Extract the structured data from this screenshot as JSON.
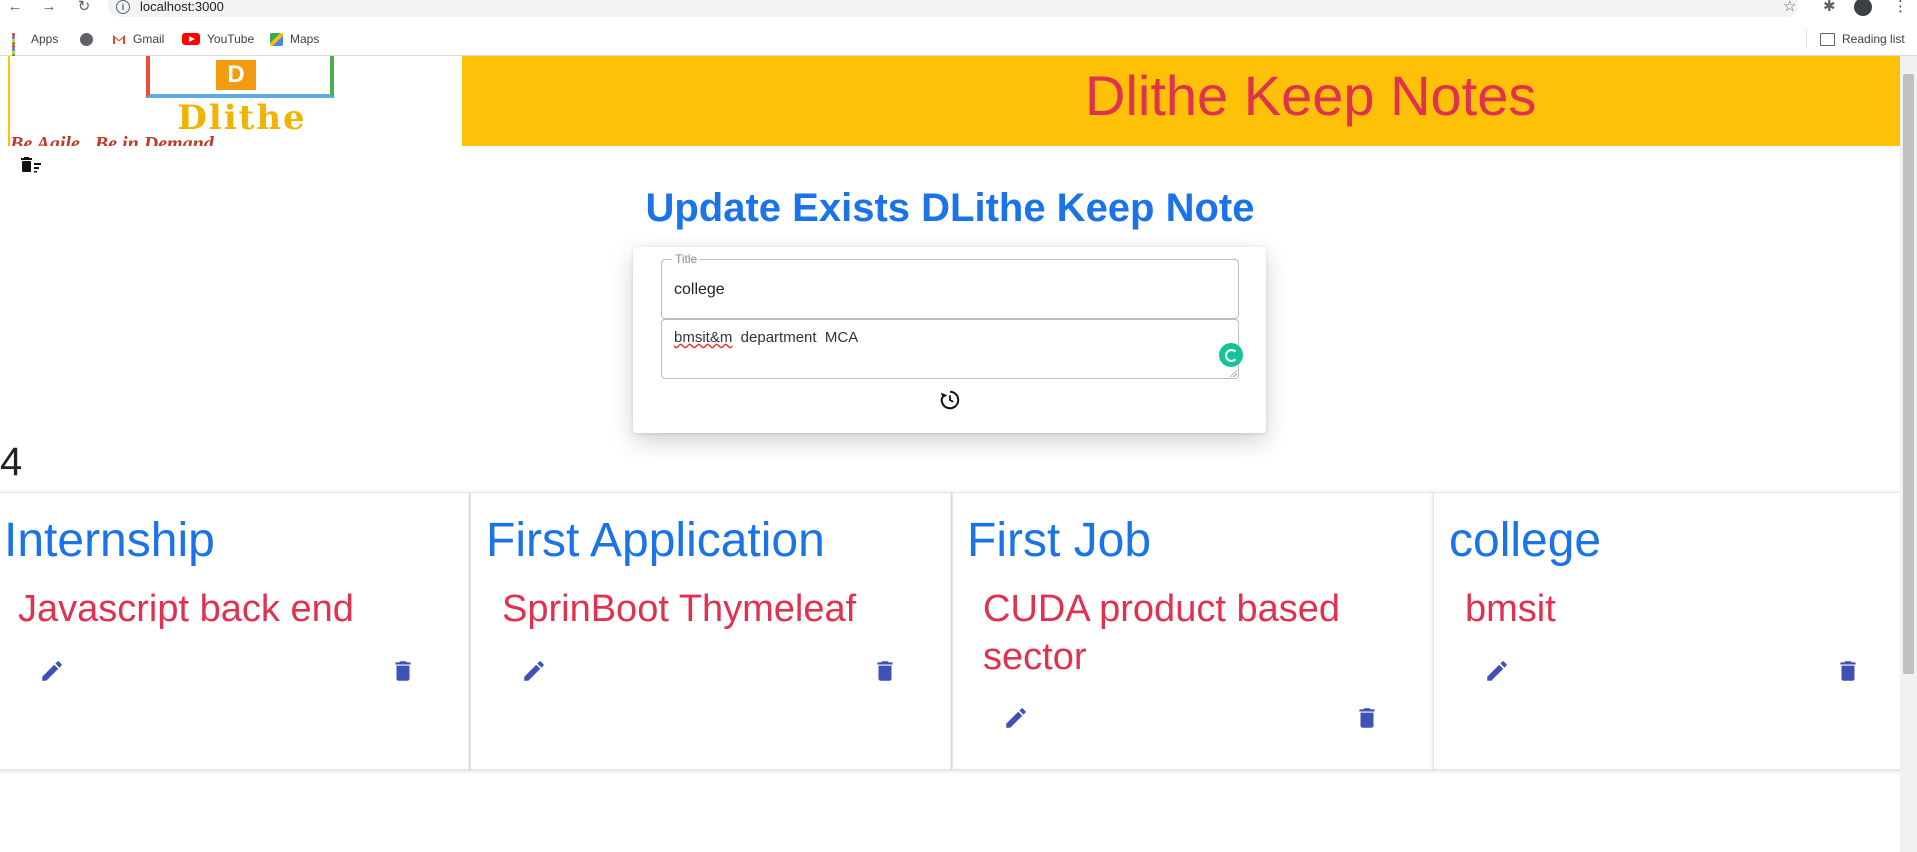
{
  "browser": {
    "url": "localhost:3000",
    "bookmarks": [
      "Apps",
      "Gmail",
      "YouTube",
      "Maps"
    ],
    "reading_list": "Reading list"
  },
  "header": {
    "logo_word": "Dlithe",
    "logo_letter": "D",
    "logo_tagline": "Be Agile.. Be in Demand",
    "title": "Dlithe Keep Notes"
  },
  "form": {
    "heading": "Update Exists DLithe Keep Note",
    "title_legend": "Title",
    "title_value": "college",
    "body_word1": "bmsit&m",
    "body_rest": "  department  MCA"
  },
  "notes_count": "4",
  "notes": [
    {
      "title": "Internship",
      "content": "Javascript back end"
    },
    {
      "title": "First Application",
      "content": "SprinBoot Thymeleaf"
    },
    {
      "title": "First Job",
      "content": "CUDA product based sector"
    },
    {
      "title": "college",
      "content": "bmsit"
    }
  ],
  "colors": {
    "header_bg": "#ffc107",
    "title_red": "#e0314f",
    "heading_blue": "#1a73e8",
    "action_icon": "#3f51b5"
  },
  "icons": {
    "update": "refresh-clock-icon",
    "edit": "pencil-icon",
    "delete": "trash-icon",
    "menu": "trash-list-icon"
  }
}
